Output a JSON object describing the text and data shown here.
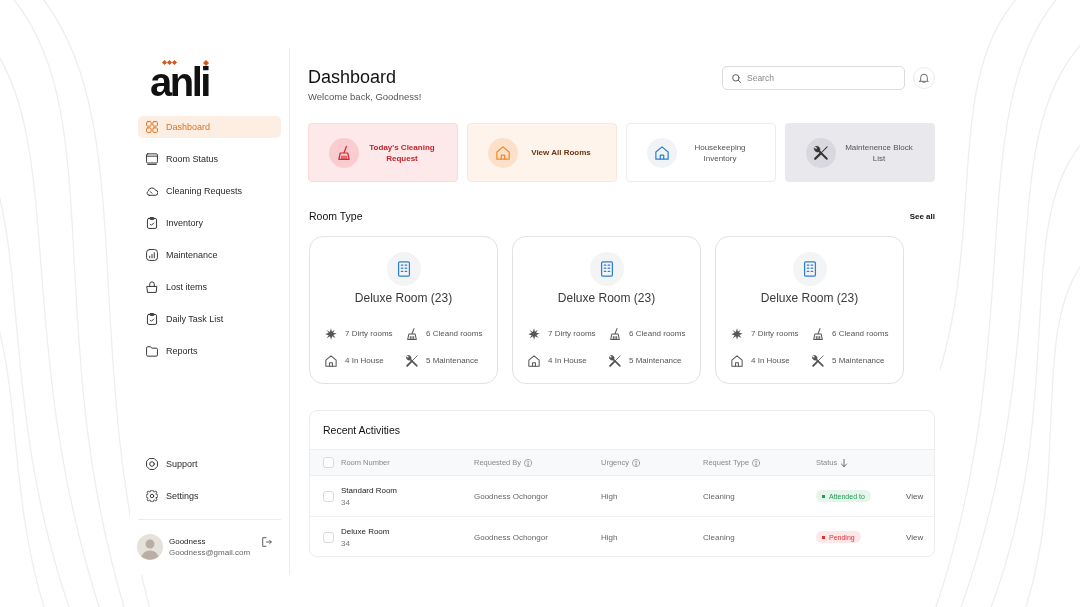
{
  "brand": {
    "name": "anli"
  },
  "sidebar": {
    "items": [
      {
        "label": "Dashboard",
        "selected": true
      },
      {
        "label": "Room Status",
        "selected": false
      },
      {
        "label": "Cleaning Requests",
        "selected": false
      },
      {
        "label": "Inventory",
        "selected": false
      },
      {
        "label": "Maintenance",
        "selected": false
      },
      {
        "label": "Lost items",
        "selected": false
      },
      {
        "label": "Daily Task List",
        "selected": false
      },
      {
        "label": "Reports",
        "selected": false
      }
    ],
    "bottom_items": [
      {
        "label": "Support",
        "selected": false
      },
      {
        "label": "Settings",
        "selected": false
      }
    ]
  },
  "user": {
    "name": "Goodness",
    "email": "Goodness@gmail.com"
  },
  "header": {
    "title": "Dashboard",
    "subtitle": "Welcome back, Goodness!",
    "search": {
      "placeholder": "Search"
    }
  },
  "quick_actions": [
    {
      "label": "Today's Cleaning Request"
    },
    {
      "label": "View All Rooms"
    },
    {
      "label": "Housekeeping Inventory"
    },
    {
      "label": "Maintenence Block List"
    }
  ],
  "room_types": {
    "title": "Room Type",
    "link": "See all",
    "cards": [
      {
        "name": "Deluxe Room (23)",
        "stats": [
          "7 Dirty rooms",
          "6 Cleand rooms",
          "4 In House",
          "5 Maintenance"
        ]
      },
      {
        "name": "Deluxe Room (23)",
        "stats": [
          "7 Dirty rooms",
          "6 Cleand rooms",
          "4 In House",
          "5 Maintenance"
        ]
      },
      {
        "name": "Deluxe Room (23)",
        "stats": [
          "7 Dirty rooms",
          "6 Cleand rooms",
          "4 In House",
          "5 Maintenance"
        ]
      }
    ]
  },
  "recent_activities": {
    "title": "Recent Activities",
    "header_checked": false,
    "columns": [
      {
        "label": "Room Number",
        "help": false,
        "sorted": false
      },
      {
        "label": "Requested By",
        "help": true,
        "sorted": false
      },
      {
        "label": "Urgency",
        "help": true,
        "sorted": false
      },
      {
        "label": "Request Type",
        "help": true,
        "sorted": false
      },
      {
        "label": "Status",
        "help": false,
        "sorted": true
      }
    ],
    "rows": [
      {
        "checked": false,
        "room": "Standard Room",
        "number": "34",
        "requested_by": "Goodness Ochongor",
        "urgency": "High",
        "request_type": "Cleaning",
        "status": {
          "label": "Attended to",
          "color": "#1f9d55"
        },
        "action": "View"
      },
      {
        "checked": false,
        "room": "Deluxe Room",
        "number": "34",
        "requested_by": "Goodness Ochongor",
        "urgency": "High",
        "request_type": "Cleaning",
        "status": {
          "label": "Pending",
          "color": "#e0302f"
        },
        "action": "View"
      }
    ]
  }
}
